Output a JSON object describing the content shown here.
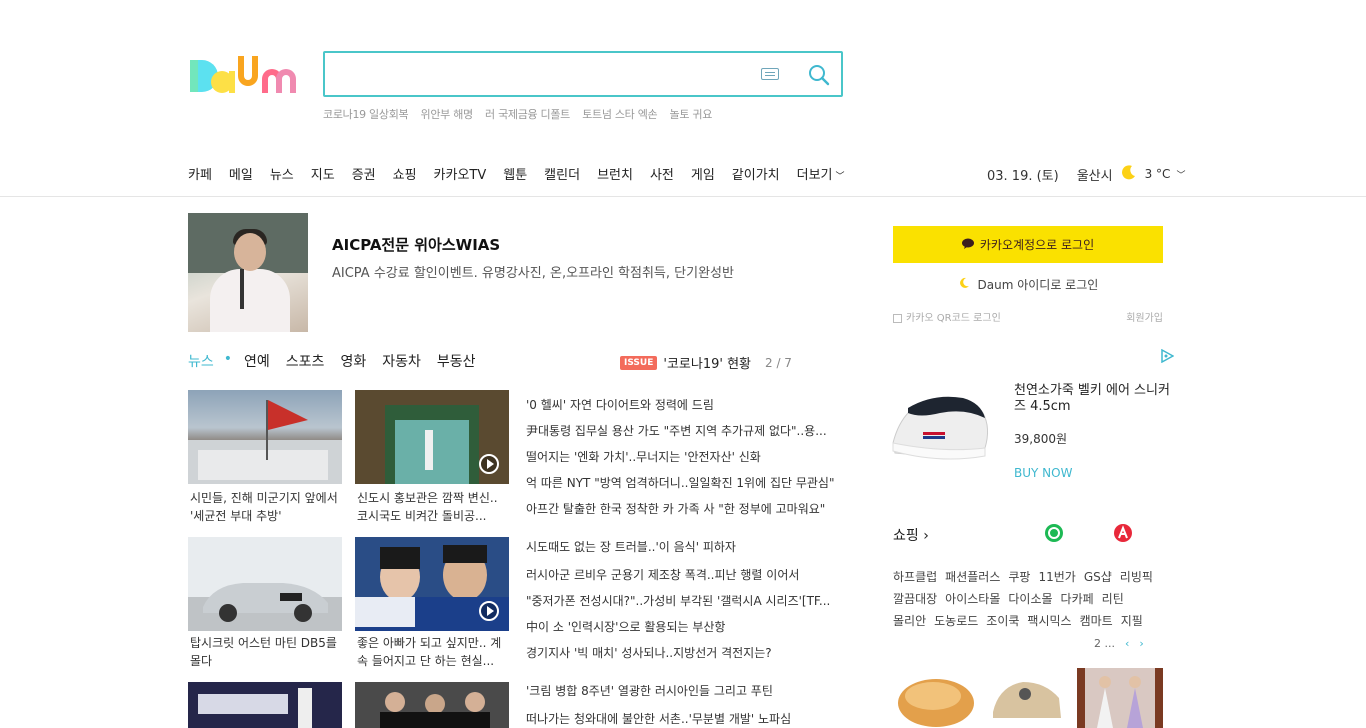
{
  "header": {
    "logo_text": "Daum",
    "search": {
      "value": "",
      "placeholder": ""
    },
    "trending": [
      "코로나19 일상회복",
      "위안부 해명",
      "러 국제금융 디폴트",
      "토트넘 스타 엑손",
      "놀토 귀요"
    ],
    "gnb": [
      "카페",
      "메일",
      "뉴스",
      "지도",
      "증권",
      "쇼핑",
      "카카오TV",
      "웹툰",
      "캘린더",
      "브런치",
      "사전",
      "게임",
      "같이가치",
      "더보기"
    ],
    "date": "03. 19. (토)",
    "location": "울산시",
    "temperature": "3 °C"
  },
  "ad": {
    "title": "AICPA전문 위아스WIAS",
    "description": "AICPA 수강료 할인이벤트. 유명강사진, 온,오프라인 학점취득, 단기완성반"
  },
  "news": {
    "tabs": [
      "뉴스",
      "연예",
      "스포츠",
      "영화",
      "자동차",
      "부동산"
    ],
    "issue_badge": "ISSUE",
    "issue_title": "'코로나19' 현황",
    "issue_page": "2 / 7",
    "cards": [
      {
        "caption": "시민들, 진해 미군기지 앞에서 '세균전 부대 추방'"
      },
      {
        "caption": "신도시 홍보관은 깜짝 변신.. 코시국도 비켜간 돌비공..."
      },
      {
        "caption": "탑시크릿 어스턴 마틴 DB5를 몰다"
      },
      {
        "caption": "좋은 아빠가 되고 싶지만.. 계속 들어지고 단 하는 현실..."
      }
    ],
    "headlines": [
      "'0 헬씨' 자연 다이어트와 정력에 드림",
      "尹대통령 집무실 용산 가도 \"주변 지역 추가규제 없다\"..용...",
      "떨어지는 '엔화 가치'..무너지는 '안전자산' 신화",
      "억 따른 NYT \"방역 엄격하더니..일일확진 1위에 집단 무관심\"",
      "아프간 탈출한 한국 정착한 카 가족 사 \"한 정부에 고마워요\"",
      "시도때도 없는 장 트러블..'이 음식' 피하자",
      "러시아군 르비우 군용기 제조창 폭격..피난 행렬 이어서",
      "\"중저가폰 전성시대?\"..가성비 부각된 '갤럭시A 시리즈'[TF...",
      "中이 소 '인력시장'으로 활용되는 부산항",
      "경기지사 '빅 매치' 성사되나..지방선거 격전지는?",
      "'크림 병합 8주년' 열광한 러시아인들 그리고 푸틴",
      "떠나가는 청와대에 불안한 서촌..'무분별 개발' 노파심"
    ]
  },
  "login": {
    "kakao_label": "카카오계정으로 로그인",
    "daum_label": "Daum 아이디로 로그인",
    "qr_label": "카카오 QR코드 로그인",
    "signup_label": "회원가입"
  },
  "shopping_ad": {
    "product_name": "천연소가죽 벨키 에어 스니커즈 4.5cm",
    "price": "39,800원",
    "buy_label": "BUY NOW"
  },
  "shopping": {
    "title": "쇼핑 ›",
    "links": [
      "하프클럽",
      "패션플러스",
      "쿠팡",
      "11번가",
      "GS샵",
      "리빙픽",
      "깔끔대장",
      "아이스타몰",
      "다이소몰",
      "다카페",
      "리틴",
      "몰리안",
      "도농로드",
      "조이쿡",
      "팩시믹스",
      "캠마트",
      "지필"
    ],
    "page": "2 ...",
    "prev": "‹",
    "next": "›"
  },
  "colors": {
    "accent": "#3fb8cf",
    "kakao_yellow": "#fae100",
    "issue_red": "#f36b5b"
  }
}
